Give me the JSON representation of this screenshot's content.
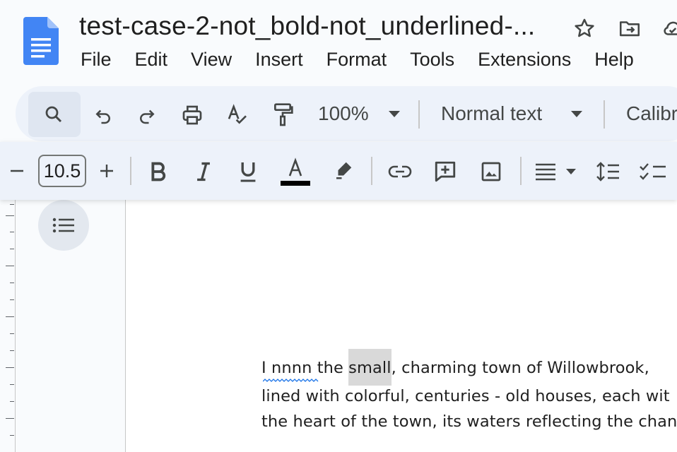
{
  "document": {
    "title": "test-case-2-not_bold-not_underlined-..."
  },
  "menu": [
    "File",
    "Edit",
    "View",
    "Insert",
    "Format",
    "Tools",
    "Extensions",
    "Help"
  ],
  "toolbar": {
    "zoom": "100%",
    "paragraph_style": "Normal text",
    "font": "Calibr",
    "font_size": "10.5",
    "text_color": "#000000"
  },
  "icons": [
    "docs-logo-icon",
    "star-icon",
    "move-to-folder-icon",
    "cloud-status-icon",
    "search-icon",
    "undo-icon",
    "redo-icon",
    "print-icon",
    "spellcheck-icon",
    "paint-format-icon",
    "chevron-down-icon",
    "minus-icon",
    "plus-icon",
    "bold-icon",
    "italic-icon",
    "underline-icon",
    "text-color-icon",
    "highlighter-icon",
    "link-icon",
    "add-comment-icon",
    "insert-image-icon",
    "align-icon",
    "line-spacing-icon",
    "checklist-icon",
    "outline-icon"
  ],
  "body": {
    "line1_a": "I  nnnn",
    "line1_b": " the ",
    "line1_sel": "small",
    "line1_c": ", charming town of Willowbrook,",
    "line2": "lined with colorful, centuries - old houses, each wit",
    "line3": "the heart of the town, its waters reflecting the chang"
  },
  "colors": {
    "accent": "#1a73e8",
    "toolbar_bg": "#edf2fa",
    "selection": "#d9d9d9"
  }
}
